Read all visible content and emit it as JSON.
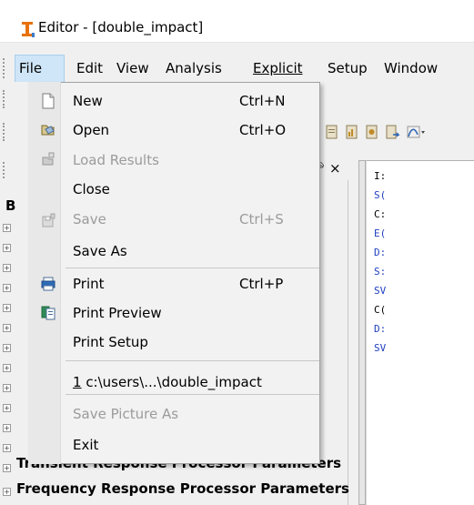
{
  "window": {
    "title": "Editor - [double_impact]"
  },
  "menubar": {
    "items": [
      "File",
      "Edit",
      "View",
      "Analysis",
      "Explicit",
      "Setup",
      "Window"
    ]
  },
  "file_menu": {
    "items": [
      {
        "label": "New",
        "shortcut": "Ctrl+N",
        "icon": "new-file-icon",
        "enabled": true
      },
      {
        "label": "Open",
        "shortcut": "Ctrl+O",
        "icon": "open-folder-icon",
        "enabled": true
      },
      {
        "label": "Load Results",
        "shortcut": "",
        "icon": "load-results-icon",
        "enabled": false
      },
      {
        "label": "Close",
        "shortcut": "",
        "icon": "",
        "enabled": true
      },
      {
        "label": "Save",
        "shortcut": "Ctrl+S",
        "icon": "save-icon",
        "enabled": false
      },
      {
        "label": "Save As",
        "shortcut": "",
        "icon": "",
        "enabled": true
      },
      {
        "label": "Print",
        "shortcut": "Ctrl+P",
        "icon": "printer-icon",
        "enabled": true
      },
      {
        "label": "Print Preview",
        "shortcut": "",
        "icon": "print-preview-icon",
        "enabled": true
      },
      {
        "label": "Print Setup",
        "shortcut": "",
        "icon": "",
        "enabled": true
      },
      {
        "label": "1 c:\\users\\...\\double_impact",
        "shortcut": "",
        "icon": "",
        "enabled": true
      },
      {
        "label": "Save Picture As",
        "shortcut": "",
        "icon": "",
        "enabled": false
      },
      {
        "label": "Exit",
        "shortcut": "",
        "icon": "",
        "enabled": true
      }
    ]
  },
  "panel": {
    "tree_letter": "B",
    "tree_items": [
      "Transient Response Processor Parameters",
      "Frequency Response Processor Parameters"
    ]
  },
  "editor": {
    "lines": [
      {
        "text": "I:",
        "color": "#000000"
      },
      {
        "text": "S(",
        "color": "#1f3fbf"
      },
      {
        "text": "C:",
        "color": "#000000"
      },
      {
        "text": "E(",
        "color": "#1f3fbf"
      },
      {
        "text": "D:",
        "color": "#1f3fbf"
      },
      {
        "text": "S:",
        "color": "#1f3fbf"
      },
      {
        "text": "SV",
        "color": "#1f3fbf"
      },
      {
        "text": "C(",
        "color": "#000000"
      },
      {
        "text": "D:",
        "color": "#1f3fbf"
      },
      {
        "text": "SV",
        "color": "#1f3fbf"
      }
    ]
  },
  "colors": {
    "menu_highlight": "#cfe6f8",
    "keyword_blue": "#1f3fbf",
    "app_icon_orange": "#e8720c"
  }
}
